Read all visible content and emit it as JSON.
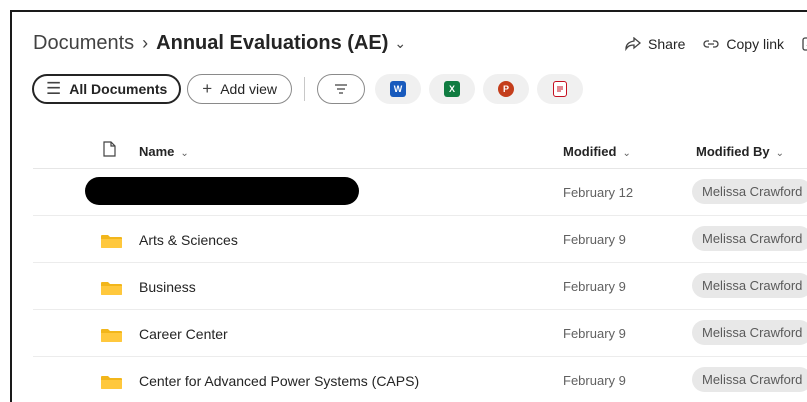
{
  "breadcrumb": {
    "root": "Documents",
    "separator": "›",
    "current": "Annual Evaluations (AE)"
  },
  "actions": {
    "share": "Share",
    "copy_link": "Copy link"
  },
  "toolbar": {
    "all_documents": "All Documents",
    "add_view": "Add view"
  },
  "apps": [
    {
      "name": "word-icon",
      "color": "#185abd",
      "letter": "W"
    },
    {
      "name": "excel-icon",
      "color": "#107c41",
      "letter": "X"
    },
    {
      "name": "powerpoint-icon",
      "color": "#c43e1c",
      "letter": "P"
    },
    {
      "name": "forms-icon",
      "color": "#c50f1f",
      "letter": ""
    }
  ],
  "columns": {
    "name": "Name",
    "modified": "Modified",
    "modified_by": "Modified By"
  },
  "rows": [
    {
      "name": "",
      "redacted": true,
      "modified": "February 12",
      "modified_by": "Melissa Crawford"
    },
    {
      "name": "Arts & Sciences",
      "modified": "February 9",
      "modified_by": "Melissa Crawford"
    },
    {
      "name": "Business",
      "modified": "February 9",
      "modified_by": "Melissa Crawford"
    },
    {
      "name": "Career Center",
      "modified": "February 9",
      "modified_by": "Melissa Crawford"
    },
    {
      "name": "Center for Advanced Power Systems (CAPS)",
      "modified": "February 9",
      "modified_by": "Melissa Crawford"
    }
  ]
}
